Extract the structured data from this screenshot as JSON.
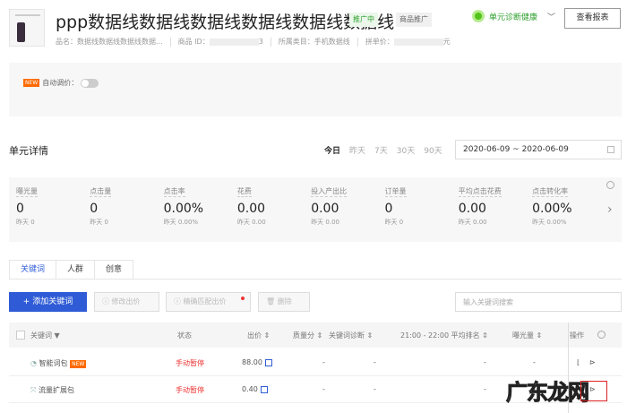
{
  "header": {
    "title": "ppp数据线数据线数据线数据线数据线数据线",
    "status_badge": "推广中",
    "type_badge": "商品推广",
    "meta": {
      "name": "品名：数据线数据线数据线数据...",
      "product_id_label": "商品 ID：",
      "product_id_suffix": "3",
      "category": "所属类目：手机数据线",
      "price_label": "拼单价：",
      "price_suffix": "元"
    },
    "diagnosis": "单元诊断健康",
    "report_button": "查看报表"
  },
  "auto_price": {
    "new_tag": "NEW",
    "label": "自动调价：",
    "enabled": false
  },
  "detail": {
    "title": "单元详情",
    "date_tabs": [
      "今日",
      "昨天",
      "7天",
      "30天",
      "90天"
    ],
    "active_tab": "今日",
    "date_range": "2020-06-09 ~ 2020-06-09"
  },
  "stats": [
    {
      "label": "曝光量",
      "value": "0",
      "yesterday": "昨天 0"
    },
    {
      "label": "点击量",
      "value": "0",
      "yesterday": "昨天 0"
    },
    {
      "label": "点击率",
      "value": "0.00%",
      "yesterday": "昨天 0.00%"
    },
    {
      "label": "花费",
      "value": "0.00",
      "yesterday": "昨天 0.00"
    },
    {
      "label": "投入产出比",
      "value": "0.00",
      "yesterday": "昨天 0.00"
    },
    {
      "label": "订单量",
      "value": "0",
      "yesterday": "昨天 0"
    },
    {
      "label": "平均点击花费",
      "value": "0.00",
      "yesterday": "昨天 0.00"
    },
    {
      "label": "点击转化率",
      "value": "0.00%",
      "yesterday": "昨天 0.00%"
    }
  ],
  "tabs": [
    "关键词",
    "人群",
    "创意"
  ],
  "toolbar": {
    "add": "+ 添加关键词",
    "modify": "ⓘ 修改出价",
    "exact": "ⓘ 精确匹配出价",
    "delete": "删除",
    "search_placeholder": "输入关键词搜索"
  },
  "table": {
    "headers": {
      "keyword": "关键词 ▼",
      "status": "状态",
      "bid": "出价 ⇕",
      "quality": "质量分 ⇕",
      "diagnosis": "关键词诊断 ⇕",
      "rank": "21:00 - 22:00 平均排名 ⇕",
      "impressions": "曝光量 ⇕",
      "action": "操作"
    },
    "rows": [
      {
        "keyword": "智能词包",
        "new": "NEW",
        "status": "手动暂停",
        "bid": "88.00",
        "quality": "-",
        "diagnosis": "-",
        "rank": "-",
        "impressions": "-"
      },
      {
        "keyword": "流量扩展包",
        "status": "手动暂停",
        "bid": "0.40",
        "quality": "-",
        "diagnosis": "-",
        "rank": "-",
        "impressions": "-"
      }
    ]
  },
  "watermark": "广东龙网"
}
